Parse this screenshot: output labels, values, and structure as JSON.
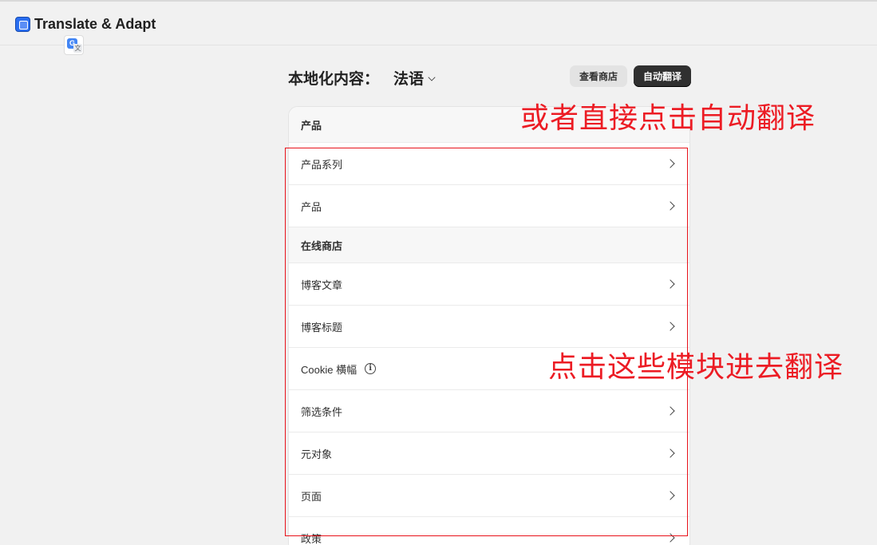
{
  "app": {
    "title": "Translate & Adapt"
  },
  "header": {
    "title_prefix": "本地化内容：",
    "language": "法语",
    "view_store_label": "查看商店",
    "auto_translate_label": "自动翻译"
  },
  "sections": [
    {
      "title": "产品",
      "items": [
        "产品系列",
        "产品"
      ]
    },
    {
      "title": "在线商店",
      "items": [
        "博客文章",
        "博客标题",
        "Cookie 横幅",
        "筛选条件",
        "元对象",
        "页面",
        "政策"
      ]
    }
  ],
  "annotations": {
    "top": "或者直接点击自动翻译",
    "middle": "点击这些模块进去翻译"
  },
  "colors": {
    "annotation": "#ec1c24",
    "primary_button": "#303030"
  },
  "icons": {
    "app": "translate-app-icon",
    "extension": "google-translate-icon",
    "info": "info-icon",
    "row_arrow": "chevron-right-icon"
  }
}
